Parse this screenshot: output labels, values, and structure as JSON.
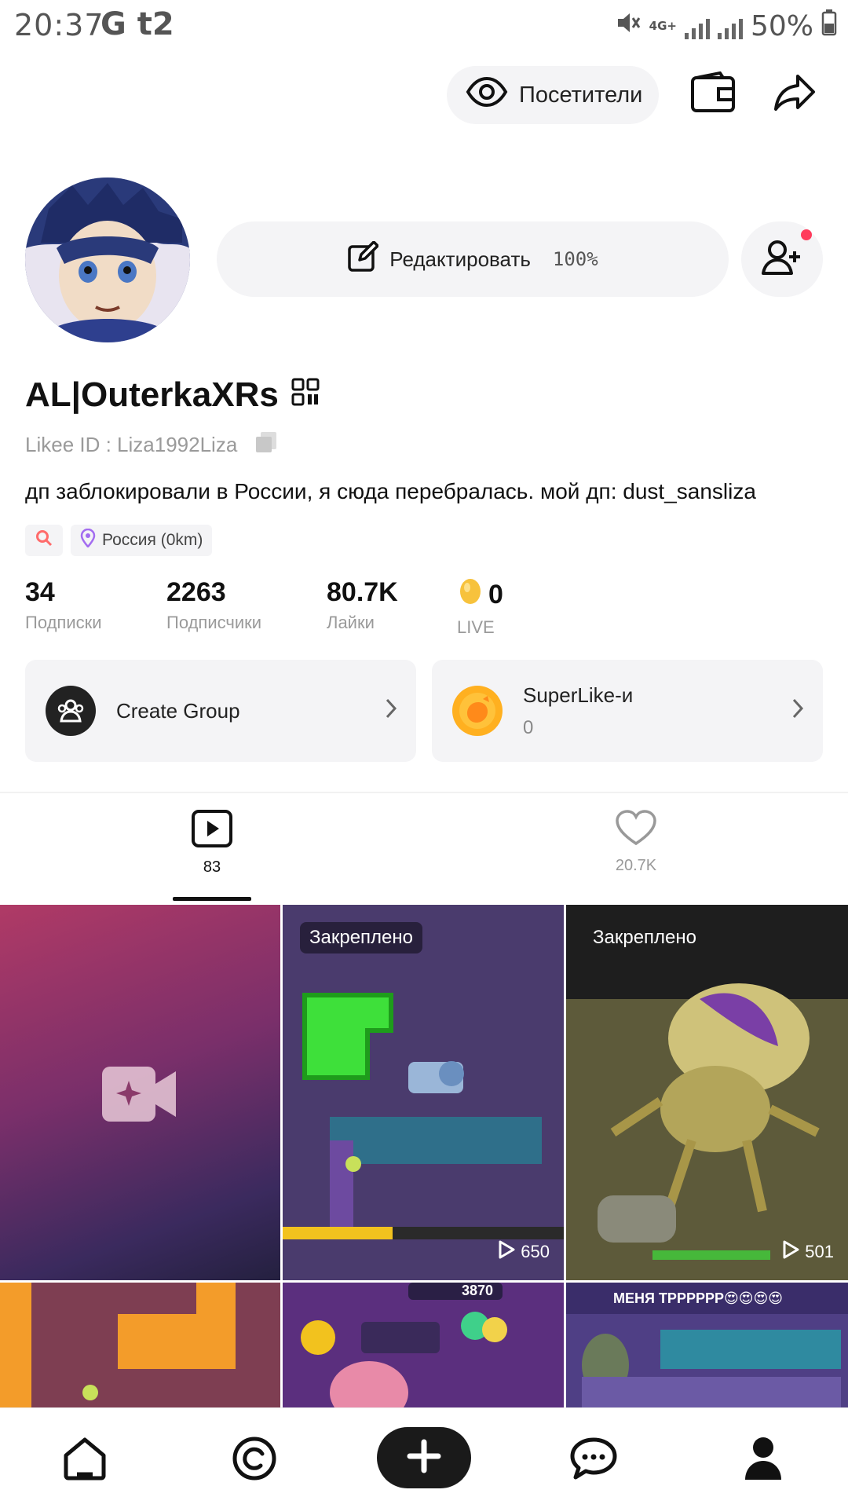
{
  "status_bar": {
    "time": "20:37",
    "carrier": "G t2",
    "network": "4G+",
    "battery": "50%"
  },
  "header": {
    "visitors_label": "Посетители"
  },
  "profile": {
    "edit_label": "Редактировать",
    "completion": "100%",
    "username": "AL|OuterkaXRs",
    "likee_id": "Likee ID : Liza1992Liza",
    "bio": "дп заблокировали в России, я сюда перебралась. мой дп: dust_sansliza",
    "location": "Россия (0km)"
  },
  "stats": [
    {
      "value": "34",
      "label": "Подписки"
    },
    {
      "value": "2263",
      "label": "Подписчики"
    },
    {
      "value": "80.7K",
      "label": "Лайки"
    },
    {
      "value": "0",
      "label": "LIVE"
    }
  ],
  "cards": {
    "group_label": "Create Group",
    "superlike_label": "SuperLike-и",
    "superlike_count": "0"
  },
  "tabs": [
    {
      "count": "83",
      "icon": "video-play-icon",
      "active": true
    },
    {
      "count": "20.7K",
      "icon": "heart-icon",
      "active": false
    }
  ],
  "videos": [
    {
      "pinned": "",
      "plays": ""
    },
    {
      "pinned": "Закреплено",
      "plays": "650"
    },
    {
      "pinned": "Закреплено",
      "plays": "501"
    },
    {
      "pinned": "",
      "plays": ""
    },
    {
      "pinned": "",
      "plays": "",
      "overlay": "3870"
    },
    {
      "pinned": "",
      "plays": "",
      "overlay": "МЕНЯ ТРРРРРР😍😍😍😍"
    }
  ],
  "colors": {
    "accent_dot": "#ff3b5c",
    "card_bg": "#f4f4f6",
    "superlike": "#ffb020"
  }
}
